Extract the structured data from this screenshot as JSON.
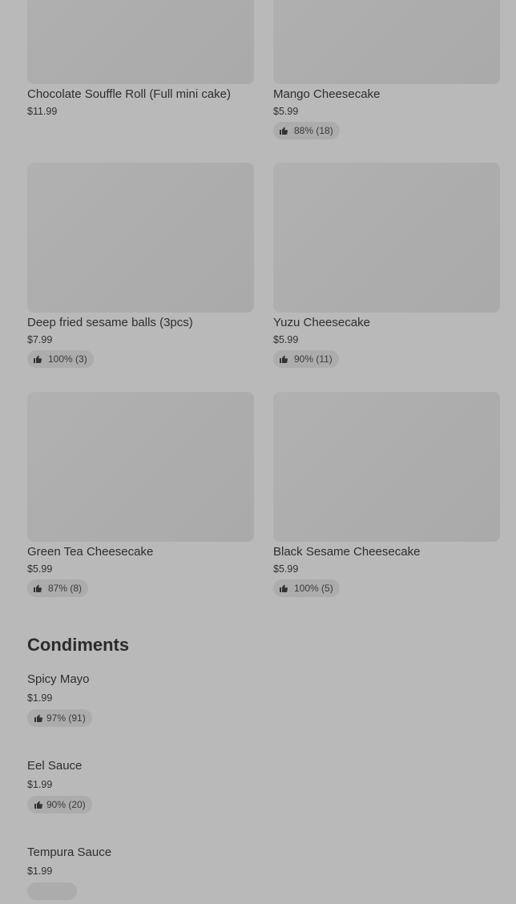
{
  "items": [
    {
      "name": "Chocolate Souffle Roll (Full mini cake)",
      "price": "$11.99",
      "rating": ""
    },
    {
      "name": "Mango Cheesecake",
      "price": "$5.99",
      "rating": "88% (18)"
    },
    {
      "name": "Deep fried sesame balls (3pcs)",
      "price": "$7.99",
      "rating": "100% (3)"
    },
    {
      "name": "Yuzu Cheesecake",
      "price": "$5.99",
      "rating": "90% (11)"
    },
    {
      "name": "Green Tea Cheesecake",
      "price": "$5.99",
      "rating": "87% (8)"
    },
    {
      "name": "Black Sesame Cheesecake",
      "price": "$5.99",
      "rating": "100% (5)"
    }
  ],
  "condiments": {
    "title": "Condiments",
    "items": [
      {
        "name": "Spicy Mayo",
        "price": "$1.99",
        "rating": "97% (91)"
      },
      {
        "name": "Eel Sauce",
        "price": "$1.99",
        "rating": "90% (20)"
      },
      {
        "name": "Tempura Sauce",
        "price": "$1.99",
        "rating": ""
      }
    ]
  },
  "icons": {
    "rating": "thumbs-up-icon"
  },
  "colors": {
    "overlay_background": "#b9b9b9",
    "image_placeholder": "#adadad",
    "badge_background": "#acacac",
    "text": "#2e2e2e"
  }
}
